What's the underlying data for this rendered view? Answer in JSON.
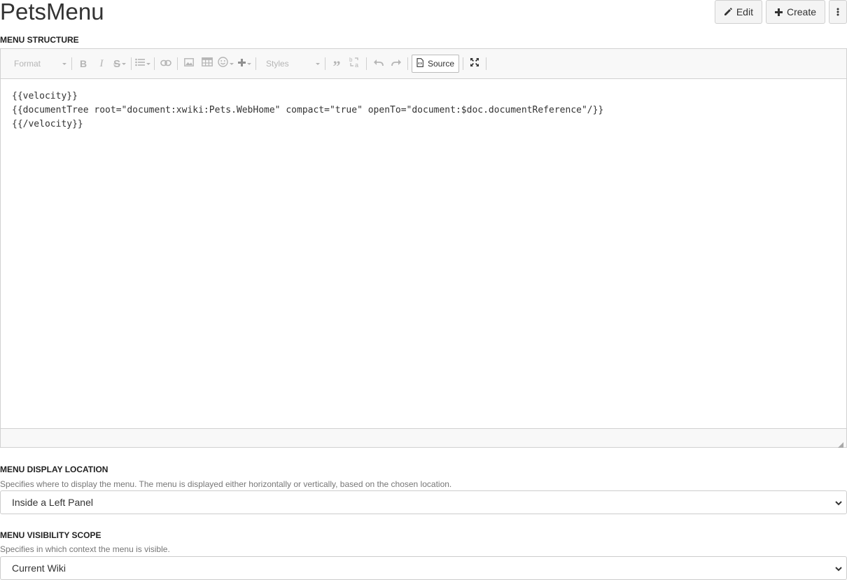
{
  "page": {
    "title": "PetsMenu"
  },
  "actions": {
    "edit_label": "Edit",
    "create_label": "Create"
  },
  "menu_structure": {
    "label": "MENU STRUCTURE",
    "toolbar": {
      "format_label": "Format",
      "styles_label": "Styles",
      "source_label": "Source"
    },
    "content_lines": [
      "{{velocity}}",
      "{{documentTree root=\"document:xwiki:Pets.WebHome\" compact=\"true\" openTo=\"document:$doc.documentReference\"/}}",
      "{{/velocity}}"
    ]
  },
  "display_location": {
    "label": "MENU DISPLAY LOCATION",
    "hint": "Specifies where to display the menu. The menu is displayed either horizontally or vertically, based on the chosen location.",
    "value": "Inside a Left Panel"
  },
  "visibility_scope": {
    "label": "MENU VISIBILITY SCOPE",
    "hint": "Specifies in which context the menu is visible.",
    "value": "Current Wiki"
  },
  "colors": {
    "toolbar_bg": "#f8f8f8",
    "border": "#d1d1d1",
    "disabled_icon": "#b5b5b5",
    "text": "#333333"
  }
}
